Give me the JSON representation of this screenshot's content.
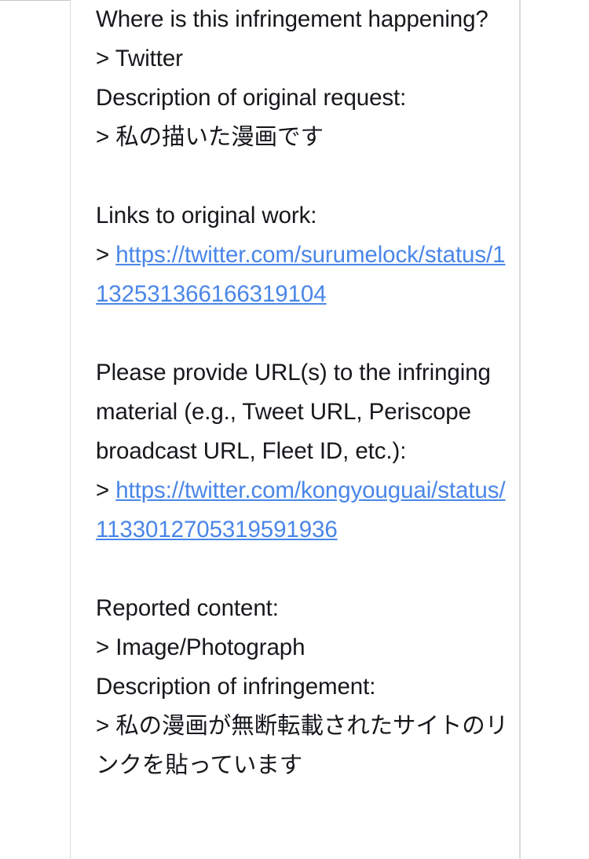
{
  "document": {
    "type": "copyright-infringement-report",
    "text_color": "#16181c",
    "link_color": "#4a86e8",
    "divider_color": "#dcdcdc",
    "background": "#ffffff"
  },
  "sections": [
    {
      "id": "location",
      "question": "Where is this infringement happening?",
      "answer_prefix": ">",
      "answer": "Twitter"
    },
    {
      "id": "original_request",
      "question": "Description of original request:",
      "answer_prefix": ">",
      "answer": "私の描いた漫画です"
    },
    {
      "id": "original_work_links",
      "question": "Links to original work:",
      "answer_prefix": ">",
      "answer": "https://twitter.com/surumelock/status/1132531366166319104",
      "answer_is_link": true
    },
    {
      "id": "infringing_urls",
      "question": "Please provide URL(s) to the infringing material (e.g., Tweet URL, Periscope broadcast URL, Fleet ID, etc.):",
      "answer_prefix": ">",
      "answer": "https://twitter.com/kongyouguai/status/1133012705319591936",
      "answer_is_link": true
    },
    {
      "id": "reported_content",
      "question": "Reported content:",
      "answer_prefix": ">",
      "answer": "Image/Photograph"
    },
    {
      "id": "infringement_description",
      "question": "Description of infringement:",
      "answer_prefix": ">",
      "answer": "私の漫画が無断転載されたサイトのリンクを貼っています"
    }
  ]
}
